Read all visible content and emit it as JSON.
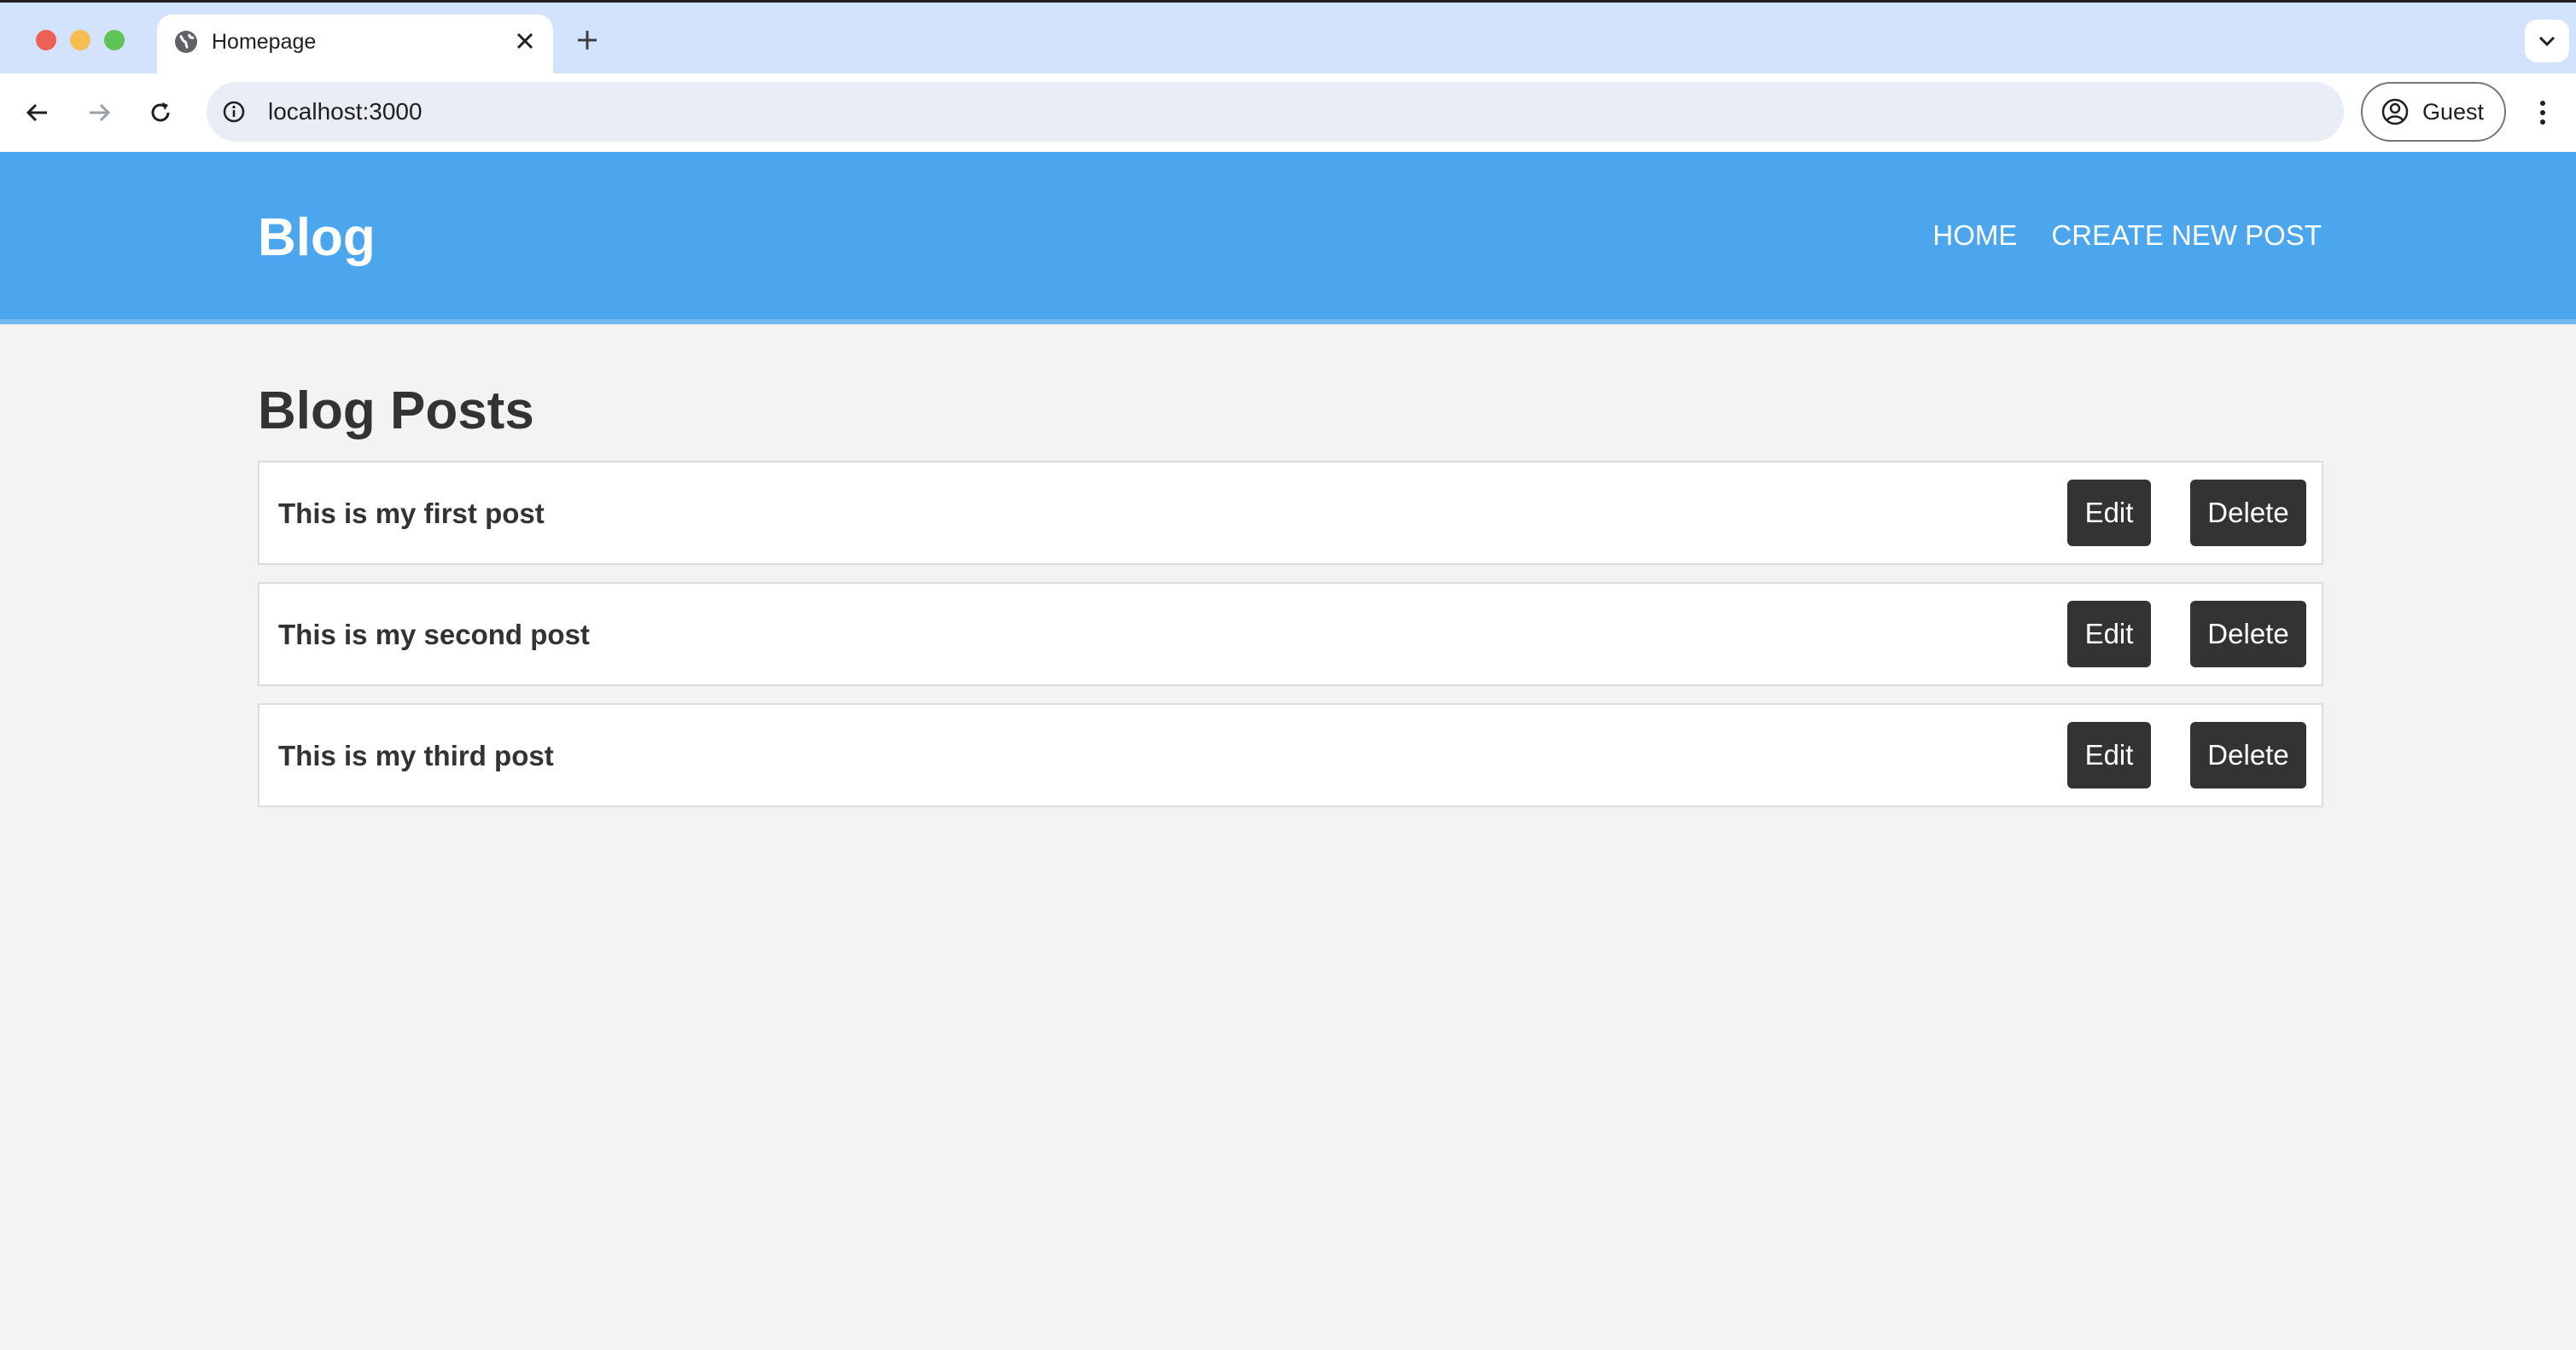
{
  "browser": {
    "tab_title": "Homepage",
    "url": "localhost:3000",
    "profile_label": "Guest"
  },
  "site": {
    "brand": "Blog",
    "nav": [
      {
        "label": "HOME"
      },
      {
        "label": "CREATE NEW POST"
      }
    ]
  },
  "main": {
    "heading": "Blog Posts",
    "posts": [
      {
        "title": "This is my first post",
        "edit_label": "Edit",
        "delete_label": "Delete"
      },
      {
        "title": "This is my second post",
        "edit_label": "Edit",
        "delete_label": "Delete"
      },
      {
        "title": "This is my third post",
        "edit_label": "Edit",
        "delete_label": "Delete"
      }
    ]
  },
  "colors": {
    "header_bg": "#4ba6ee",
    "button_bg": "#333333",
    "page_bg": "#f3f3f3"
  }
}
